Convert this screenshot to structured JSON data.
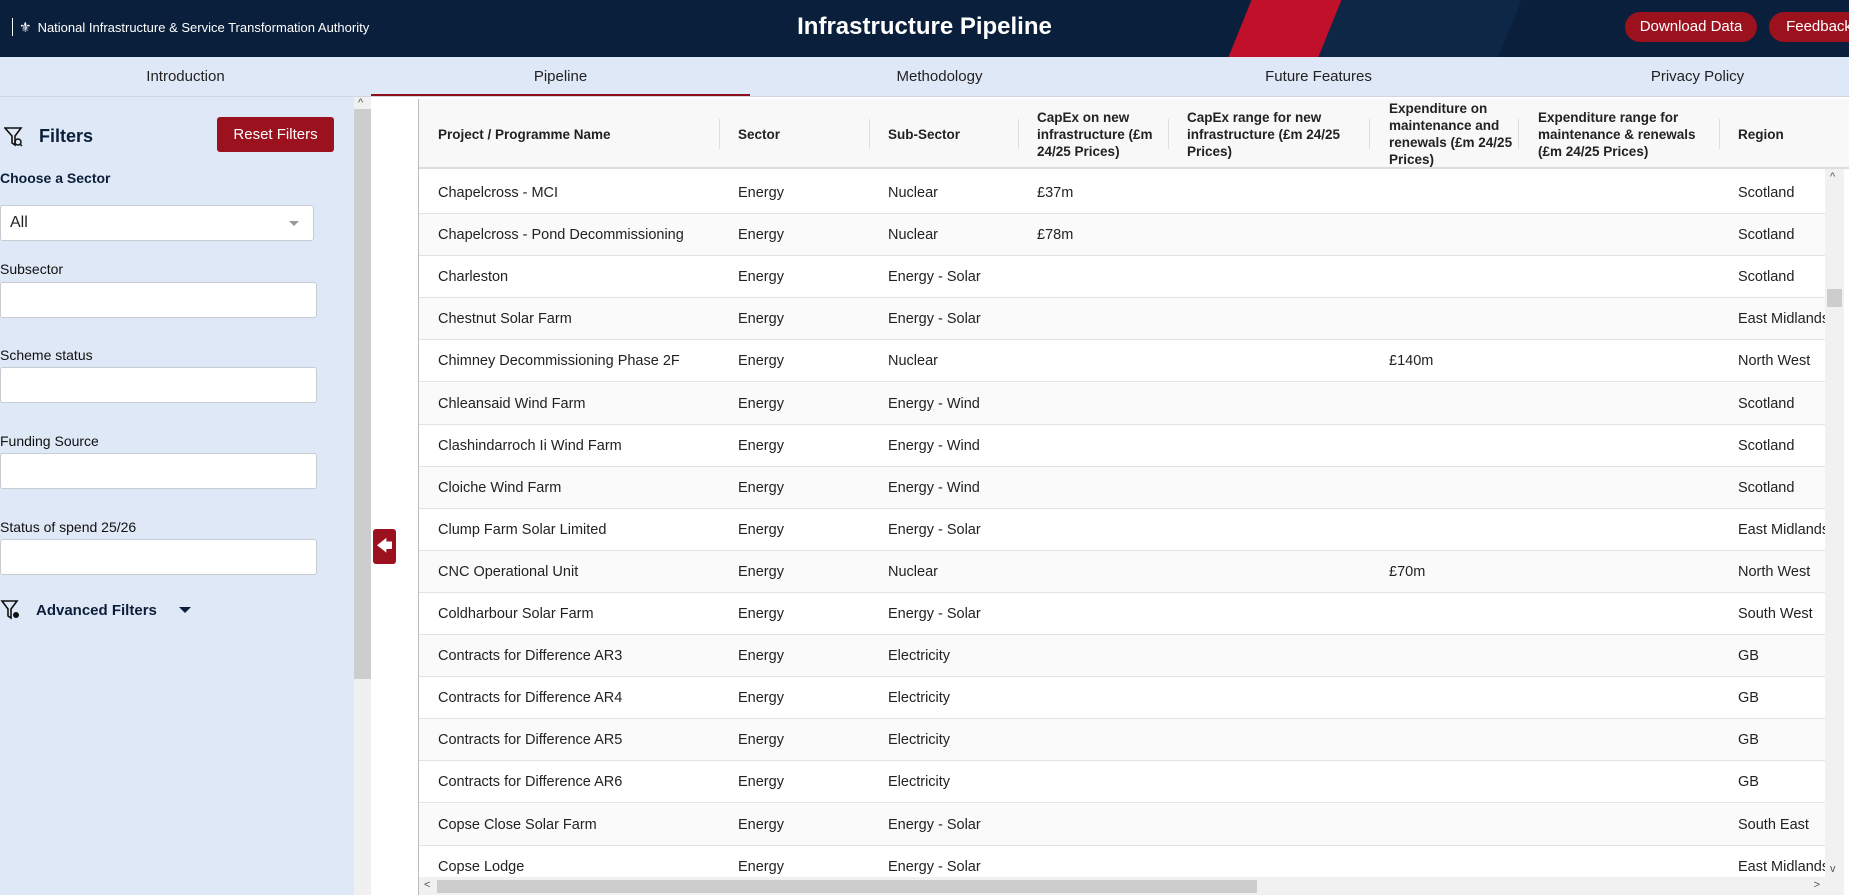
{
  "header": {
    "org": "National Infrastructure & Service Transformation Authority",
    "title": "Infrastructure Pipeline",
    "download_label": "Download Data",
    "feedback_label": "Feedback",
    "colors": {
      "navy": "#0a1f3b",
      "red": "#9b111e"
    }
  },
  "tabs": [
    "Introduction",
    "Pipeline",
    "Methodology",
    "Future Features",
    "Privacy Policy"
  ],
  "sidebar": {
    "title": "Filters",
    "reset_label": "Reset Filters",
    "sector_label": "Choose a Sector",
    "sector_value": "All",
    "subsector_label": "Subsector",
    "scheme_label": "Scheme status",
    "funding_label": "Funding Source",
    "spend_label": "Status of spend 25/26",
    "advanced_label": "Advanced Filters"
  },
  "table": {
    "columns": [
      "Project / Programme Name",
      "Sector",
      "Sub-Sector",
      "CapEx on new infrastructure (£m 24/25 Prices)",
      "CapEx range for new infrastructure (£m 24/25 Prices)",
      "Expenditure on maintenance and renewals (£m 24/25 Prices)",
      "Expenditure range for maintenance & renewals (£m 24/25 Prices)",
      "Region"
    ],
    "rows": [
      [
        "Chapelcross - MCI",
        "Energy",
        "Nuclear",
        "£37m",
        "",
        "",
        "",
        "Scotland"
      ],
      [
        "Chapelcross - Pond Decommissioning",
        "Energy",
        "Nuclear",
        "£78m",
        "",
        "",
        "",
        "Scotland"
      ],
      [
        "Charleston",
        "Energy",
        "Energy - Solar",
        "",
        "",
        "",
        "",
        "Scotland"
      ],
      [
        "Chestnut Solar Farm",
        "Energy",
        "Energy - Solar",
        "",
        "",
        "",
        "",
        "East Midlands"
      ],
      [
        "Chimney Decommissioning Phase 2F",
        "Energy",
        "Nuclear",
        "",
        "",
        "£140m",
        "",
        "North West"
      ],
      [
        "Chleansaid Wind Farm",
        "Energy",
        "Energy - Wind",
        "",
        "",
        "",
        "",
        "Scotland"
      ],
      [
        "Clashindarroch Ii Wind Farm",
        "Energy",
        "Energy - Wind",
        "",
        "",
        "",
        "",
        "Scotland"
      ],
      [
        "Cloiche Wind Farm",
        "Energy",
        "Energy - Wind",
        "",
        "",
        "",
        "",
        "Scotland"
      ],
      [
        "Clump Farm Solar Limited",
        "Energy",
        "Energy - Solar",
        "",
        "",
        "",
        "",
        "East Midlands"
      ],
      [
        "CNC Operational Unit",
        "Energy",
        "Nuclear",
        "",
        "",
        "£70m",
        "",
        "North West"
      ],
      [
        "Coldharbour Solar Farm",
        "Energy",
        "Energy - Solar",
        "",
        "",
        "",
        "",
        "South West"
      ],
      [
        "Contracts for Difference AR3",
        "Energy",
        "Electricity",
        "",
        "",
        "",
        "",
        "GB"
      ],
      [
        "Contracts for Difference AR4",
        "Energy",
        "Electricity",
        "",
        "",
        "",
        "",
        "GB"
      ],
      [
        "Contracts for Difference AR5",
        "Energy",
        "Electricity",
        "",
        "",
        "",
        "",
        "GB"
      ],
      [
        "Contracts for Difference AR6",
        "Energy",
        "Electricity",
        "",
        "",
        "",
        "",
        "GB"
      ],
      [
        "Copse Close Solar Farm",
        "Energy",
        "Energy - Solar",
        "",
        "",
        "",
        "",
        "South East"
      ],
      [
        "Copse Lodge",
        "Energy",
        "Energy - Solar",
        "",
        "",
        "",
        "",
        "East Midlands"
      ]
    ]
  }
}
